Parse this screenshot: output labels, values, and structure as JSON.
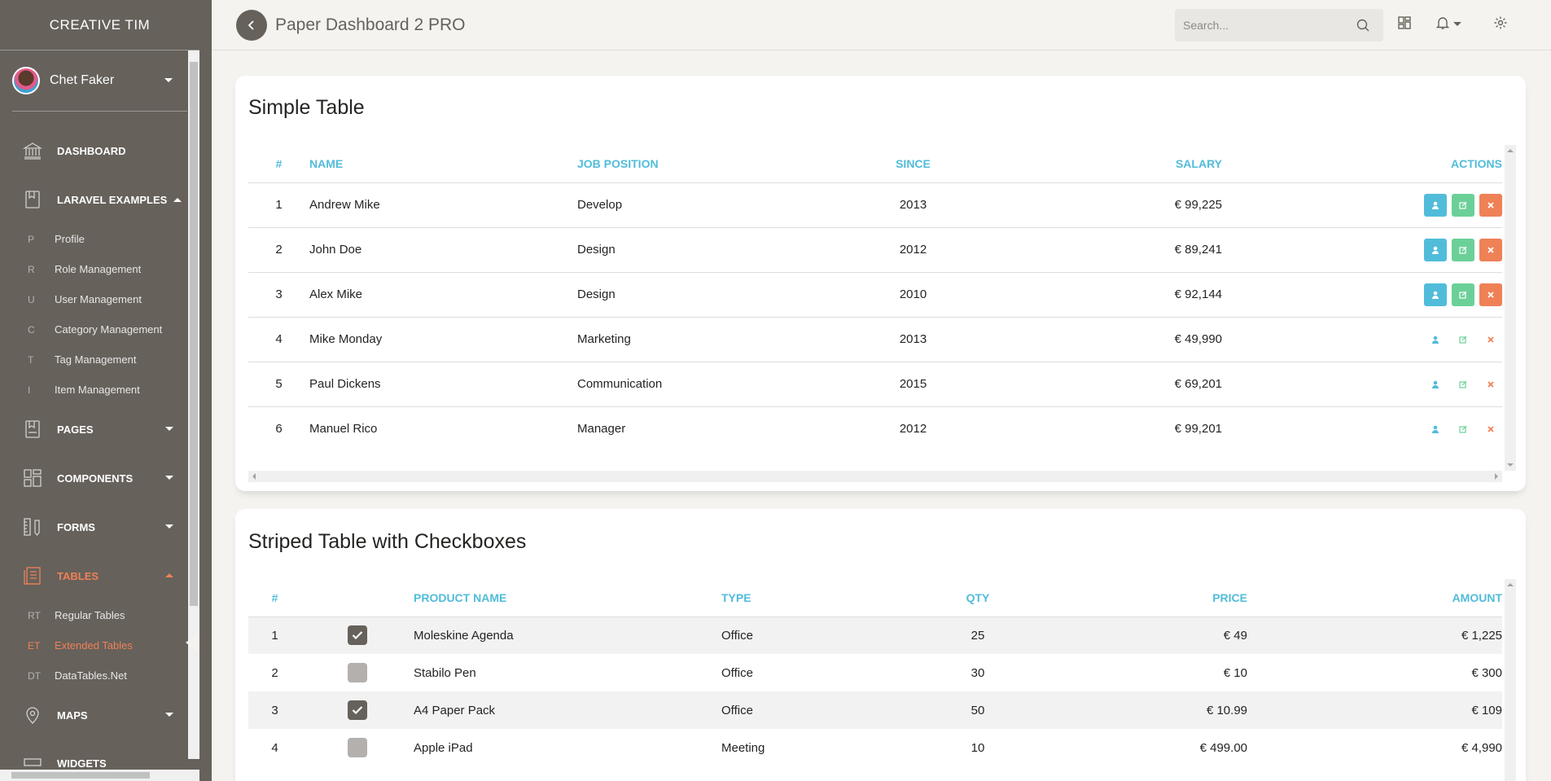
{
  "sidebar": {
    "brand": "CREATIVE TIM",
    "user": "Chet Faker",
    "items": [
      {
        "label": "DASHBOARD"
      },
      {
        "label": "LARAVEL EXAMPLES"
      },
      {
        "label": "PAGES"
      },
      {
        "label": "COMPONENTS"
      },
      {
        "label": "FORMS"
      },
      {
        "label": "TABLES"
      },
      {
        "label": "MAPS"
      },
      {
        "label": "WIDGETS"
      }
    ],
    "laravel_sub": [
      {
        "abbr": "P",
        "label": "Profile"
      },
      {
        "abbr": "R",
        "label": "Role Management"
      },
      {
        "abbr": "U",
        "label": "User Management"
      },
      {
        "abbr": "C",
        "label": "Category Management"
      },
      {
        "abbr": "T",
        "label": "Tag Management"
      },
      {
        "abbr": "I",
        "label": "Item Management"
      }
    ],
    "tables_sub": [
      {
        "abbr": "RT",
        "label": "Regular Tables"
      },
      {
        "abbr": "ET",
        "label": "Extended Tables"
      },
      {
        "abbr": "DT",
        "label": "DataTables.Net"
      }
    ],
    "accent_color": "#ef8157"
  },
  "topbar": {
    "title": "Paper Dashboard 2 PRO",
    "search_placeholder": "Search..."
  },
  "simple_table": {
    "title": "Simple Table",
    "headers": [
      "#",
      "NAME",
      "JOB POSITION",
      "SINCE",
      "SALARY",
      "ACTIONS"
    ],
    "rows": [
      {
        "id": "1",
        "name": "Andrew Mike",
        "job": "Develop",
        "since": "2013",
        "salary": "€ 99,225"
      },
      {
        "id": "2",
        "name": "John Doe",
        "job": "Design",
        "since": "2012",
        "salary": "€ 89,241"
      },
      {
        "id": "3",
        "name": "Alex Mike",
        "job": "Design",
        "since": "2010",
        "salary": "€ 92,144"
      },
      {
        "id": "4",
        "name": "Mike Monday",
        "job": "Marketing",
        "since": "2013",
        "salary": "€ 49,990"
      },
      {
        "id": "5",
        "name": "Paul Dickens",
        "job": "Communication",
        "since": "2015",
        "salary": "€ 69,201"
      },
      {
        "id": "6",
        "name": "Manuel Rico",
        "job": "Manager",
        "since": "2012",
        "salary": "€ 99,201"
      }
    ]
  },
  "striped_table": {
    "title": "Striped Table with Checkboxes",
    "headers": [
      "#",
      "",
      "PRODUCT NAME",
      "TYPE",
      "QTY",
      "PRICE",
      "AMOUNT"
    ],
    "rows": [
      {
        "id": "1",
        "checked": true,
        "name": "Moleskine Agenda",
        "type": "Office",
        "qty": "25",
        "price": "€ 49",
        "amount": "€ 1,225"
      },
      {
        "id": "2",
        "checked": false,
        "name": "Stabilo Pen",
        "type": "Office",
        "qty": "30",
        "price": "€ 10",
        "amount": "€ 300"
      },
      {
        "id": "3",
        "checked": true,
        "name": "A4 Paper Pack",
        "type": "Office",
        "qty": "50",
        "price": "€ 10.99",
        "amount": "€ 109"
      },
      {
        "id": "4",
        "checked": false,
        "name": "Apple iPad",
        "type": "Meeting",
        "qty": "10",
        "price": "€ 499.00",
        "amount": "€ 4,990"
      }
    ]
  }
}
